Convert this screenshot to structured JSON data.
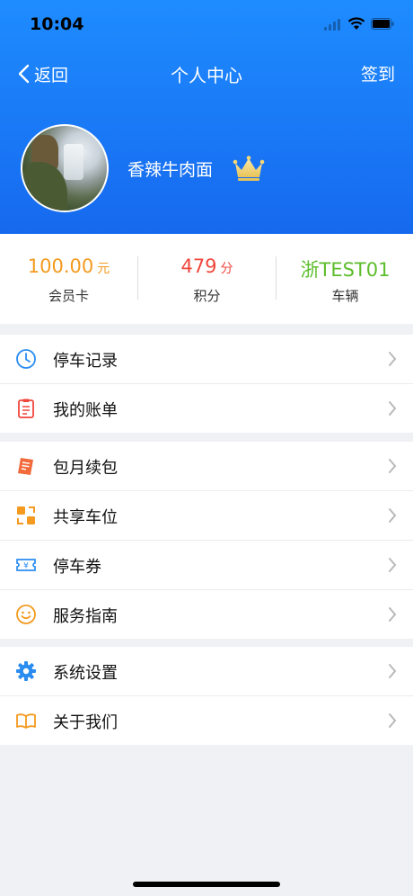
{
  "status_bar": {
    "time": "10:04"
  },
  "nav": {
    "back_label": "返回",
    "title": "个人中心",
    "signin_label": "签到"
  },
  "profile": {
    "username": "香辣牛肉面"
  },
  "stats": [
    {
      "value": "100.00",
      "unit": "元",
      "label": "会员卡",
      "color": "#f39a1f"
    },
    {
      "value": "479",
      "unit": "分",
      "label": "积分",
      "color": "#f0463c"
    },
    {
      "value": "浙TEST01",
      "unit": "",
      "label": "车辆",
      "color": "#5cbd2c"
    }
  ],
  "menu": {
    "group1": [
      {
        "label": "停车记录",
        "icon": "clock-icon"
      },
      {
        "label": "我的账单",
        "icon": "bill-icon"
      }
    ],
    "group2": [
      {
        "label": "包月续包",
        "icon": "receipt-icon"
      },
      {
        "label": "共享车位",
        "icon": "share-icon"
      },
      {
        "label": "停车券",
        "icon": "ticket-icon"
      },
      {
        "label": "服务指南",
        "icon": "smile-icon"
      }
    ],
    "group3": [
      {
        "label": "系统设置",
        "icon": "gear-icon"
      },
      {
        "label": "关于我们",
        "icon": "book-icon"
      }
    ]
  },
  "colors": {
    "header_blue": "#1e8cff",
    "accent_orange": "#f39a1f",
    "accent_red": "#f0463c",
    "accent_green": "#5cbd2c"
  }
}
